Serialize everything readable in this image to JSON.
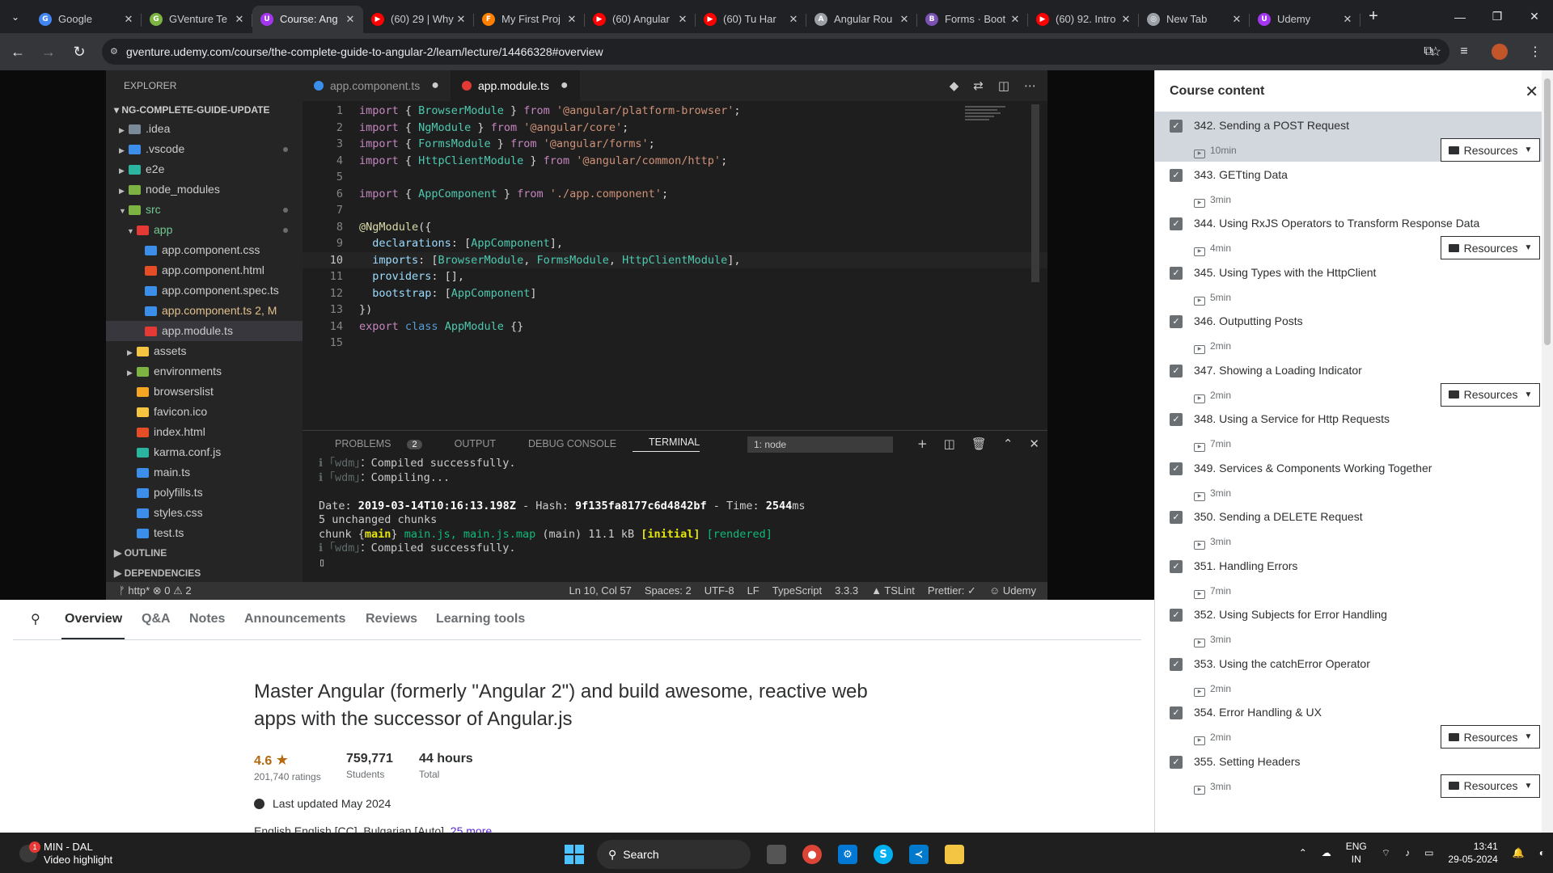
{
  "browser": {
    "tabs": [
      {
        "title": "Google",
        "color": "#4285f4",
        "glyph": "G"
      },
      {
        "title": "GVenture Te",
        "color": "#7cb342",
        "glyph": "G"
      },
      {
        "title": "Course: Ang",
        "color": "#a435f0",
        "glyph": "U"
      },
      {
        "title": "(60) 29 | Why",
        "color": "#ff0000",
        "glyph": "▶"
      },
      {
        "title": "My First Proj",
        "color": "#ff7f00",
        "glyph": "F"
      },
      {
        "title": "(60) Angular",
        "color": "#ff0000",
        "glyph": "▶"
      },
      {
        "title": "(60) Tu Har",
        "color": "#ff0000",
        "glyph": "▶"
      },
      {
        "title": "Angular Rou",
        "color": "#9aa0a6",
        "glyph": "A"
      },
      {
        "title": "Forms · Boot",
        "color": "#7952b3",
        "glyph": "B"
      },
      {
        "title": "(60) 92. Intro",
        "color": "#ff0000",
        "glyph": "▶"
      },
      {
        "title": "New Tab",
        "color": "#9aa0a6",
        "glyph": "◎"
      },
      {
        "title": "Udemy",
        "color": "#a435f0",
        "glyph": "U"
      }
    ],
    "active_tab": 2,
    "url": "gventure.udemy.com/course/the-complete-guide-to-angular-2/learn/lecture/14466328#overview"
  },
  "vscode": {
    "explorer_title": "EXPLORER",
    "project": "NG-COMPLETE-GUIDE-UPDATE",
    "tree": [
      {
        "label": ".idea",
        "depth": 1,
        "caret": "▶",
        "icon": "#7a8a99",
        "cls": ""
      },
      {
        "label": ".vscode",
        "depth": 1,
        "caret": "▶",
        "icon": "#3b8eea",
        "cls": "",
        "dot": true
      },
      {
        "label": "e2e",
        "depth": 1,
        "caret": "▶",
        "icon": "#2bb5a0",
        "cls": ""
      },
      {
        "label": "node_modules",
        "depth": 1,
        "caret": "▶",
        "icon": "#7cb342",
        "cls": ""
      },
      {
        "label": "src",
        "depth": 1,
        "caret": "▼",
        "icon": "#7cb342",
        "cls": "green",
        "dot": true
      },
      {
        "label": "app",
        "depth": 2,
        "caret": "▼",
        "icon": "#e53935",
        "cls": "green",
        "dot": true
      },
      {
        "label": "app.component.css",
        "depth": 3,
        "caret": "",
        "icon": "#3b8eea",
        "cls": ""
      },
      {
        "label": "app.component.html",
        "depth": 3,
        "caret": "",
        "icon": "#e44d26",
        "cls": ""
      },
      {
        "label": "app.component.spec.ts",
        "depth": 3,
        "caret": "",
        "icon": "#3b8eea",
        "cls": ""
      },
      {
        "label": "app.component.ts  2, M",
        "depth": 3,
        "caret": "",
        "icon": "#3b8eea",
        "cls": "mod"
      },
      {
        "label": "app.module.ts",
        "depth": 3,
        "caret": "",
        "icon": "#e53935",
        "cls": "sel"
      },
      {
        "label": "assets",
        "depth": 2,
        "caret": "▶",
        "icon": "#f5c542",
        "cls": ""
      },
      {
        "label": "environments",
        "depth": 2,
        "caret": "▶",
        "icon": "#7cb342",
        "cls": ""
      },
      {
        "label": "browserslist",
        "depth": 2,
        "caret": "",
        "icon": "#f5a623",
        "cls": ""
      },
      {
        "label": "favicon.ico",
        "depth": 2,
        "caret": "",
        "icon": "#f5c542",
        "cls": ""
      },
      {
        "label": "index.html",
        "depth": 2,
        "caret": "",
        "icon": "#e44d26",
        "cls": ""
      },
      {
        "label": "karma.conf.js",
        "depth": 2,
        "caret": "",
        "icon": "#2bb5a0",
        "cls": ""
      },
      {
        "label": "main.ts",
        "depth": 2,
        "caret": "",
        "icon": "#3b8eea",
        "cls": ""
      },
      {
        "label": "polyfills.ts",
        "depth": 2,
        "caret": "",
        "icon": "#3b8eea",
        "cls": ""
      },
      {
        "label": "styles.css",
        "depth": 2,
        "caret": "",
        "icon": "#3b8eea",
        "cls": ""
      },
      {
        "label": "test.ts",
        "depth": 2,
        "caret": "",
        "icon": "#3b8eea",
        "cls": ""
      }
    ],
    "sections": [
      "OUTLINE",
      "DEPENDENCIES"
    ],
    "editor_tabs": [
      {
        "label": "app.component.ts",
        "icon": "#3b8eea",
        "active": false
      },
      {
        "label": "app.module.ts",
        "icon": "#e53935",
        "active": true
      }
    ],
    "code": [
      [
        [
          "kw",
          "import"
        ],
        [
          "pu",
          " { "
        ],
        [
          "ty",
          "BrowserModule"
        ],
        [
          "pu",
          " } "
        ],
        [
          "kw",
          "from"
        ],
        [
          "st",
          " '@angular/platform-browser'"
        ],
        [
          "pu",
          ";"
        ]
      ],
      [
        [
          "kw",
          "import"
        ],
        [
          "pu",
          " { "
        ],
        [
          "ty",
          "NgModule"
        ],
        [
          "pu",
          " } "
        ],
        [
          "kw",
          "from"
        ],
        [
          "st",
          " '@angular/core'"
        ],
        [
          "pu",
          ";"
        ]
      ],
      [
        [
          "kw",
          "import"
        ],
        [
          "pu",
          " { "
        ],
        [
          "ty",
          "FormsModule"
        ],
        [
          "pu",
          " } "
        ],
        [
          "kw",
          "from"
        ],
        [
          "st",
          " '@angular/forms'"
        ],
        [
          "pu",
          ";"
        ]
      ],
      [
        [
          "kw",
          "import"
        ],
        [
          "pu",
          " { "
        ],
        [
          "ty",
          "HttpClientModule"
        ],
        [
          "pu",
          " } "
        ],
        [
          "kw",
          "from"
        ],
        [
          "st",
          " '@angular/common/http'"
        ],
        [
          "pu",
          ";"
        ]
      ],
      [],
      [
        [
          "kw",
          "import"
        ],
        [
          "pu",
          " { "
        ],
        [
          "ty",
          "AppComponent"
        ],
        [
          "pu",
          " } "
        ],
        [
          "kw",
          "from"
        ],
        [
          "st",
          " './app.component'"
        ],
        [
          "pu",
          ";"
        ]
      ],
      [],
      [
        [
          "fn",
          "@NgModule"
        ],
        [
          "pu",
          "({"
        ]
      ],
      [
        [
          "pr",
          "  declarations"
        ],
        [
          "pu",
          ": ["
        ],
        [
          "ty",
          "AppComponent"
        ],
        [
          "pu",
          "],"
        ]
      ],
      [
        [
          "pr",
          "  imports"
        ],
        [
          "pu",
          ": ["
        ],
        [
          "ty",
          "BrowserModule"
        ],
        [
          "pu",
          ", "
        ],
        [
          "ty",
          "FormsModule"
        ],
        [
          "pu",
          ", "
        ],
        [
          "ty",
          "HttpClientModule"
        ],
        [
          "pu",
          "],"
        ]
      ],
      [
        [
          "pr",
          "  providers"
        ],
        [
          "pu",
          ": [],"
        ]
      ],
      [
        [
          "pr",
          "  bootstrap"
        ],
        [
          "pu",
          ": ["
        ],
        [
          "ty",
          "AppComponent"
        ],
        [
          "pu",
          "]"
        ]
      ],
      [
        [
          "pu",
          "})"
        ]
      ],
      [
        [
          "kw",
          "export"
        ],
        [
          "bl",
          " class"
        ],
        [
          "ty",
          " AppModule"
        ],
        [
          "pu",
          " {}"
        ]
      ],
      []
    ],
    "current_line": 10,
    "panel_tabs": [
      "PROBLEMS",
      "OUTPUT",
      "DEBUG CONSOLE",
      "TERMINAL"
    ],
    "problems_count": "2",
    "terminal_select": "1: node",
    "terminal": [
      [
        [
          "dim",
          "ℹ ｢wdm｣"
        ],
        [
          "",
          "：Compiled successfully."
        ]
      ],
      [
        [
          "dim",
          "ℹ ｢wdm｣"
        ],
        [
          "",
          "：Compiling..."
        ]
      ],
      [],
      [
        [
          "",
          "Date: "
        ],
        [
          "b",
          "2019-03-14T10:16:13.198Z"
        ],
        [
          "",
          " - Hash: "
        ],
        [
          "b",
          "9f135fa8177c6d4842bf"
        ],
        [
          "",
          " - Time: "
        ],
        [
          "b",
          "2544"
        ],
        [
          "",
          "ms"
        ]
      ],
      [
        [
          "",
          "5 unchanged chunks"
        ]
      ],
      [
        [
          "",
          "chunk {"
        ],
        [
          "y",
          "main"
        ],
        [
          "",
          "} "
        ],
        [
          "g",
          "main.js, main.js.map"
        ],
        [
          "",
          " (main) 11.1 kB "
        ],
        [
          "y",
          "[initial]"
        ],
        [
          "",
          " "
        ],
        [
          "g",
          "[rendered]"
        ]
      ],
      [
        [
          "dim",
          "ℹ ｢wdm｣"
        ],
        [
          "",
          "：Compiled successfully."
        ]
      ],
      [
        [
          "",
          "▯"
        ]
      ]
    ],
    "status_left": "ᚠ http*   ⊗ 0 ⚠ 2",
    "status_right": [
      "Ln 10, Col 57",
      "Spaces: 2",
      "UTF-8",
      "LF",
      "TypeScript",
      "3.3.3",
      "▲ TSLint",
      "Prettier: ✓",
      "☺ Udemy"
    ]
  },
  "course_nav": {
    "items": [
      "Overview",
      "Q&A",
      "Notes",
      "Announcements",
      "Reviews",
      "Learning tools"
    ]
  },
  "overview": {
    "headline": "Master Angular (formerly \"Angular 2\") and build awesome, reactive web apps with the successor of Angular.js",
    "rating": "4.6",
    "ratings_count": "201,740 ratings",
    "students": "759,771",
    "students_label": "Students",
    "hours": "44 hours",
    "hours_label": "Total",
    "updated": "Last updated May 2024",
    "languages": "English     English [CC], Bulgarian [Auto],",
    "languages_more": "25 more"
  },
  "sidebar": {
    "title": "Course content",
    "resources_label": "Resources",
    "lectures": [
      {
        "title": "342. Sending a POST Request",
        "dur": "10min",
        "res": true,
        "current": true
      },
      {
        "title": "343. GETting Data",
        "dur": "3min",
        "res": false
      },
      {
        "title": "344. Using RxJS Operators to Transform Response Data",
        "dur": "4min",
        "res": true
      },
      {
        "title": "345. Using Types with the HttpClient",
        "dur": "5min",
        "res": false
      },
      {
        "title": "346. Outputting Posts",
        "dur": "2min",
        "res": false
      },
      {
        "title": "347. Showing a Loading Indicator",
        "dur": "2min",
        "res": true
      },
      {
        "title": "348. Using a Service for Http Requests",
        "dur": "7min",
        "res": false
      },
      {
        "title": "349. Services & Components Working Together",
        "dur": "3min",
        "res": false
      },
      {
        "title": "350. Sending a DELETE Request",
        "dur": "3min",
        "res": false
      },
      {
        "title": "351. Handling Errors",
        "dur": "7min",
        "res": false
      },
      {
        "title": "352. Using Subjects for Error Handling",
        "dur": "3min",
        "res": false
      },
      {
        "title": "353. Using the catchError Operator",
        "dur": "2min",
        "res": false
      },
      {
        "title": "354. Error Handling & UX",
        "dur": "2min",
        "res": true
      },
      {
        "title": "355. Setting Headers",
        "dur": "3min",
        "res": true
      }
    ]
  },
  "taskbar": {
    "notif_count": "1",
    "weather_line1": "MIN - DAL",
    "weather_line2": "Video highlight",
    "search": "Search",
    "lang1": "ENG",
    "lang2": "IN",
    "time": "13:41",
    "date": "29-05-2024"
  }
}
